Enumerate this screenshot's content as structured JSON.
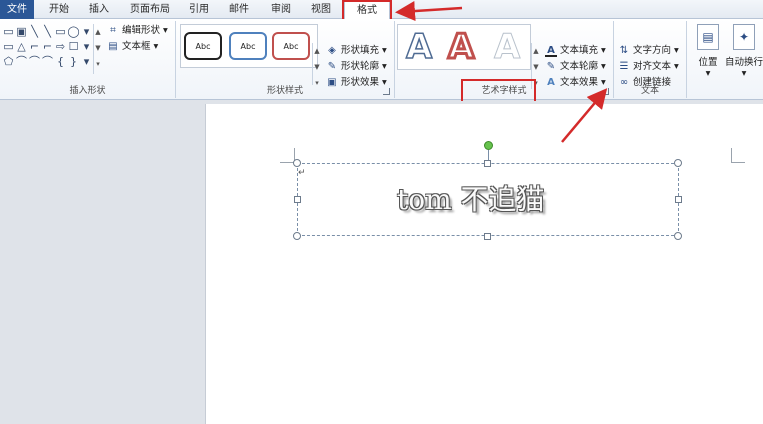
{
  "tabs": [
    {
      "label": "文件",
      "active": false
    },
    {
      "label": "开始",
      "active": false
    },
    {
      "label": "插入",
      "active": false
    },
    {
      "label": "页面布局",
      "active": false
    },
    {
      "label": "引用",
      "active": false
    },
    {
      "label": "邮件",
      "active": false
    },
    {
      "label": "审阅",
      "active": false
    },
    {
      "label": "视图",
      "active": false
    },
    {
      "label": "格式",
      "active": true
    }
  ],
  "groups": {
    "insert_shapes": {
      "label": "插入形状",
      "edit_shape": "编辑形状",
      "text_box": "文本框",
      "shapes": [
        "▭",
        "▣",
        "╲",
        "╲",
        "▭",
        "◯",
        "▾",
        "▭",
        "△",
        "⌐",
        "⌐",
        "⇨",
        "☐",
        "▾",
        "⬠",
        "⌒",
        "⌒",
        "⌒",
        "{",
        "}",
        "▾"
      ]
    },
    "shape_styles": {
      "label": "形状样式",
      "samples": [
        "Abc",
        "Abc",
        "Abc"
      ],
      "fill": "形状填充",
      "outline": "形状轮廓",
      "effects": "形状效果"
    },
    "wordart_styles": {
      "label": "艺术字样式",
      "samples": [
        "A",
        "A",
        "A"
      ],
      "text_fill": "文本填充",
      "text_outline": "文本轮廓",
      "text_effects": "文本效果"
    },
    "text": {
      "label": "文本",
      "direction": "文字方向",
      "align": "对齐文本",
      "link": "创建链接"
    },
    "arrange": {
      "position": "位置",
      "wrap": "自动换行"
    }
  },
  "document": {
    "wordart_text": "tom 不追猫"
  },
  "colors": {
    "highlight": "#d42a2a",
    "file_tab": "#2b5797",
    "handle_green": "#66c24d"
  }
}
